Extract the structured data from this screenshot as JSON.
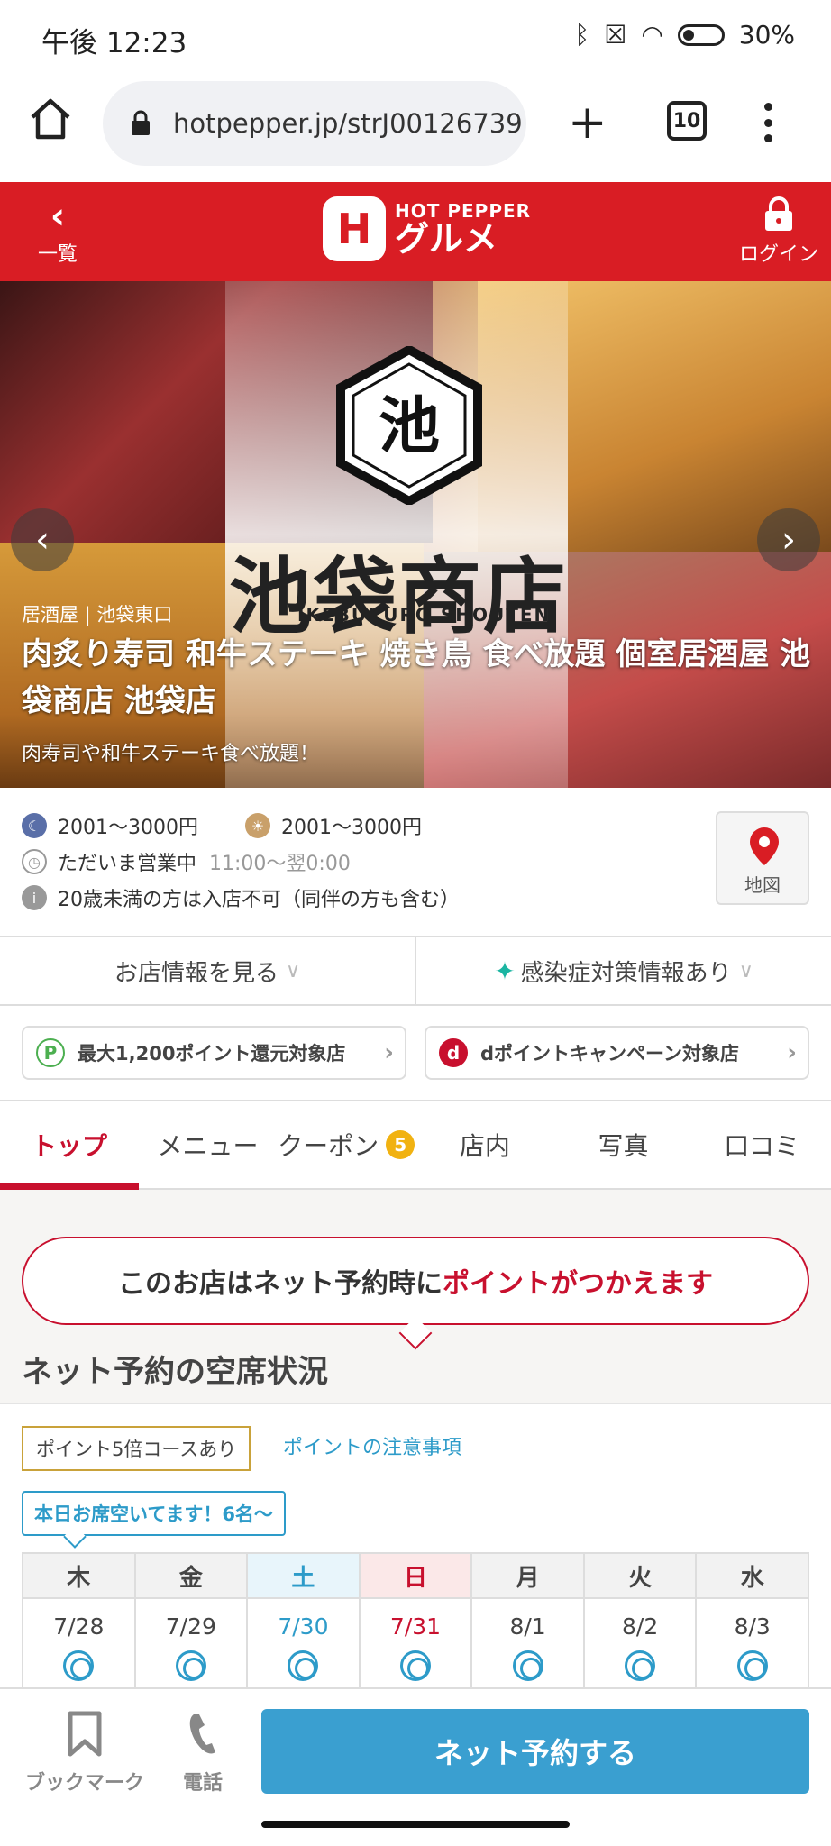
{
  "status": {
    "time": "午後 12:23",
    "battery": "30%"
  },
  "browser": {
    "url": "hotpepper.jp/strJ00126739",
    "tab_count": "10"
  },
  "header": {
    "back_label": "一覧",
    "logo_top": "HOT PEPPER",
    "logo_bottom": "グルメ",
    "login_label": "ログイン",
    "brand_color": "#d91d24"
  },
  "hero": {
    "logo_kanji": "池",
    "logo_name": "池袋商店",
    "logo_name_en": "IKEBUKURO SHOUTEN",
    "category": "居酒屋 | 池袋東口",
    "title": "肉炙り寿司 和牛ステーキ 焼き鳥 食べ放題 個室居酒屋 池袋商店 池袋店",
    "subtitle": "肉寿司や和牛ステーキ食べ放題！"
  },
  "info": {
    "dinner_budget": "2001～3000円",
    "lunch_budget": "2001～3000円",
    "open_status": "ただいま営業中",
    "hours": "11:00～翌0:00",
    "notice": "20歳未満の方は入店不可（同伴の方も含む）",
    "map_label": "地図"
  },
  "links": {
    "shop_info": "お店情報を見る",
    "infection": "感染症対策情報あり"
  },
  "campaigns": {
    "point": "最大1,200ポイント還元対象店",
    "dpoint": "dポイントキャンペーン対象店"
  },
  "tabs": [
    {
      "label": "トップ"
    },
    {
      "label": "メニュー"
    },
    {
      "label": "クーポン",
      "count": "5"
    },
    {
      "label": "店内"
    },
    {
      "label": "写真"
    },
    {
      "label": "口コミ"
    }
  ],
  "point_banner": {
    "prefix": "このお店はネット予約時に",
    "highlight": "ポイントがつかえます"
  },
  "vacancy": {
    "title": "ネット予約の空席状況",
    "course_badge": "ポイント5倍コースあり",
    "course_note": "ポイントの注意事項",
    "today_badge": "本日お席空いてます！6名～",
    "days": [
      {
        "dow": "木",
        "date": "7/28"
      },
      {
        "dow": "金",
        "date": "7/29"
      },
      {
        "dow": "土",
        "date": "7/30"
      },
      {
        "dow": "日",
        "date": "7/31"
      },
      {
        "dow": "月",
        "date": "8/1"
      },
      {
        "dow": "火",
        "date": "8/2"
      },
      {
        "dow": "水",
        "date": "8/3"
      }
    ]
  },
  "bottom": {
    "bookmark": "ブックマーク",
    "phone": "電話",
    "reserve": "ネット予約する"
  }
}
